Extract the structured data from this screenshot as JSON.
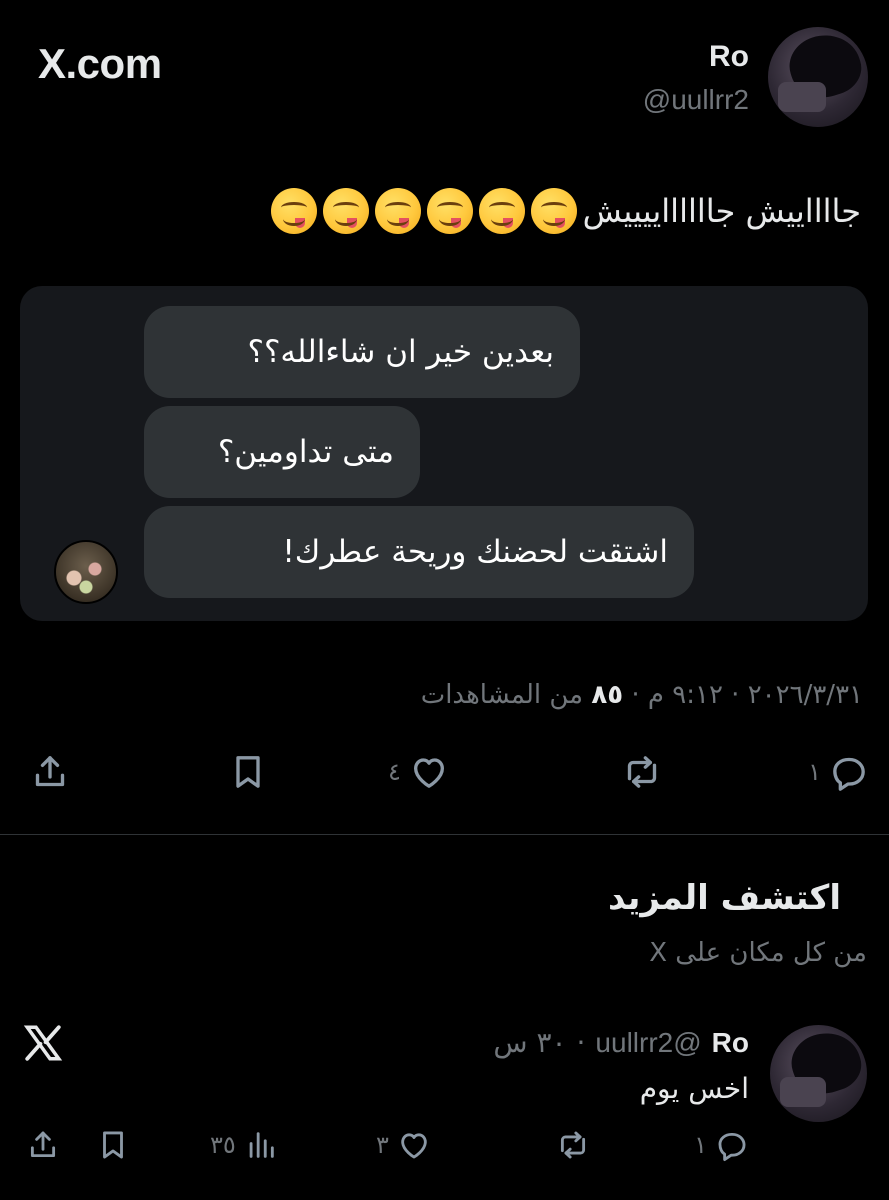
{
  "header": {
    "brand": "X.com",
    "display_name": "Ro",
    "handle": "@uullrr2"
  },
  "tweet": {
    "text": "جااااييش جااااااييييش",
    "emoji_count": 6,
    "emoji_name": "face-savoring-food"
  },
  "chat": {
    "messages": [
      "بعدين خير ان شاءالله؟؟",
      "متى تداومين؟",
      "اشتقت لحضنك وريحة عطرك!"
    ]
  },
  "meta": {
    "date": "٢٠٢٦/٣/٣١",
    "time": "٩:١٢ م",
    "views_count": "٨٥",
    "views_label": "من المشاهدات"
  },
  "actions": {
    "replies": "١",
    "retweets": "",
    "likes": "٤"
  },
  "discover": {
    "title": "اكتشف المزيد",
    "subtitle": "من كل مكان على X"
  },
  "reply_tweet": {
    "display_name": "Ro",
    "handle": "@uullrr2",
    "time": "٣٠ س",
    "text": "اخس يوم",
    "replies": "١",
    "likes": "٣",
    "views": "٣٥"
  },
  "colors": {
    "background": "#000000",
    "text": "#e7e9ea",
    "muted": "#71767b",
    "bubble": "#2f3336",
    "card": "#16181c"
  }
}
